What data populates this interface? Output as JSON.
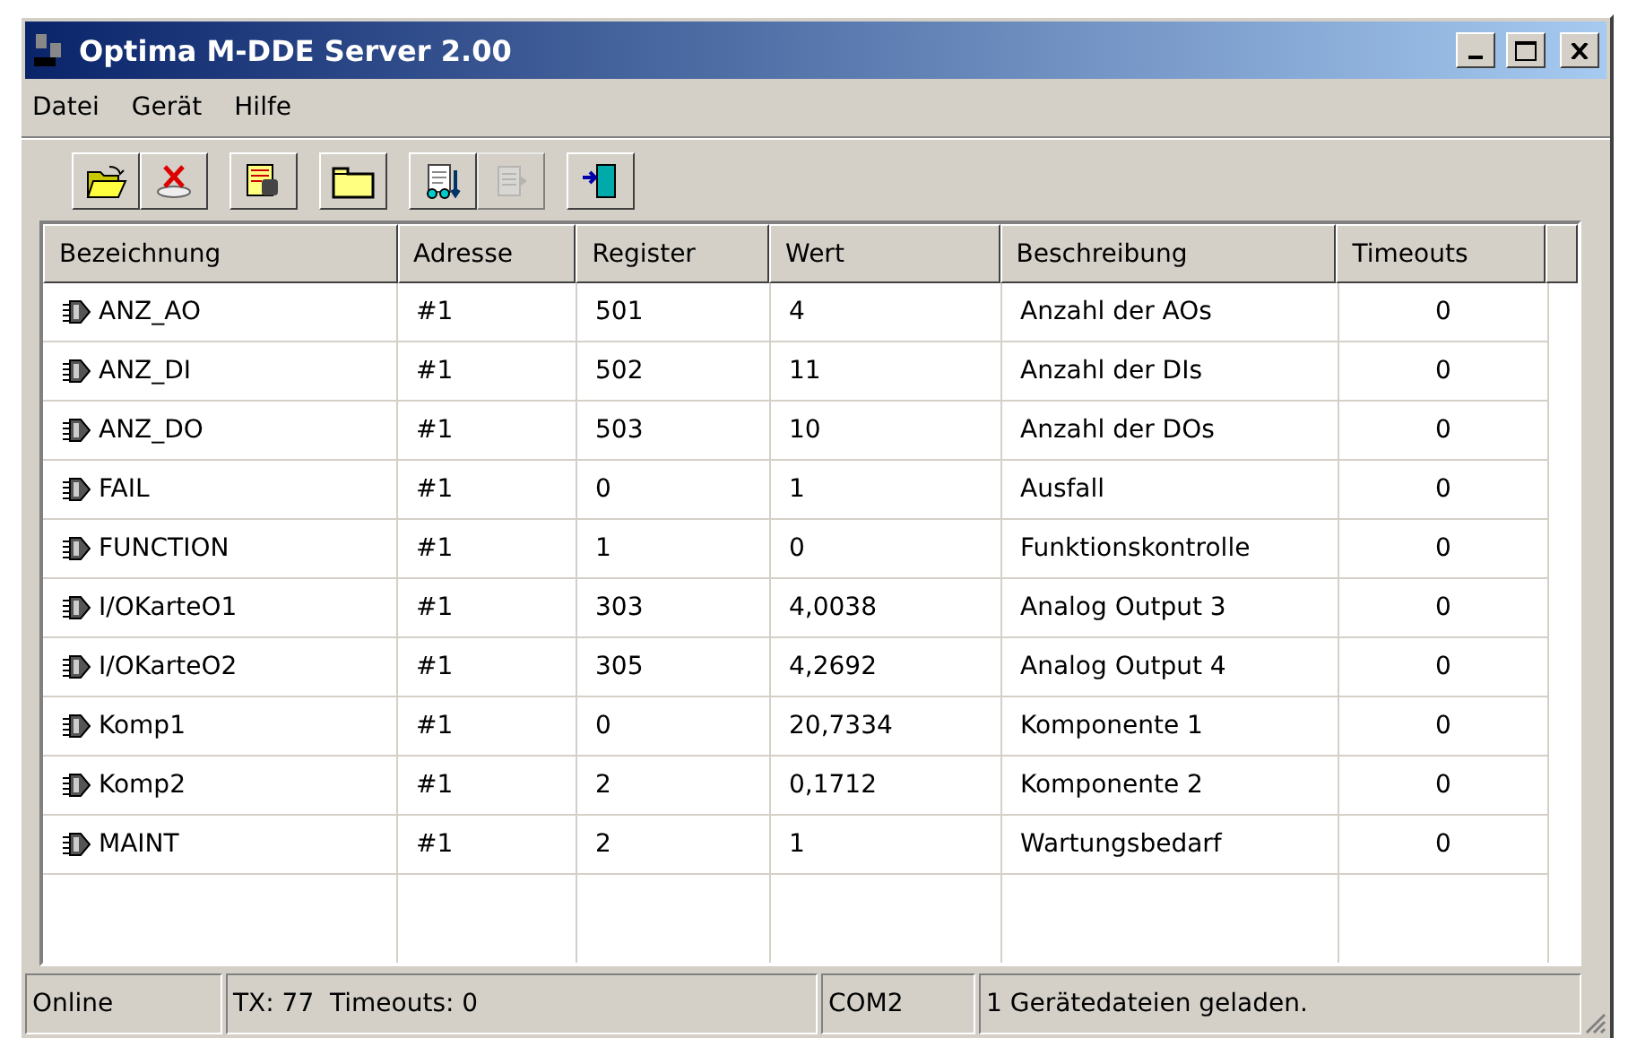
{
  "window": {
    "title": "Optima M-DDE Server 2.00"
  },
  "menu": [
    {
      "label": "Datei"
    },
    {
      "label": "Gerät"
    },
    {
      "label": "Hilfe"
    }
  ],
  "toolbar": [
    [
      {
        "kind": "open",
        "disabled": false
      },
      {
        "kind": "delete",
        "disabled": false
      }
    ],
    [
      {
        "kind": "device",
        "disabled": false
      }
    ],
    [
      {
        "kind": "folder",
        "disabled": false
      }
    ],
    [
      {
        "kind": "report",
        "disabled": false
      },
      {
        "kind": "document",
        "disabled": true
      }
    ],
    [
      {
        "kind": "exit",
        "disabled": false
      }
    ]
  ],
  "table": {
    "columns": [
      "Bezeichnung",
      "Adresse",
      "Register",
      "Wert",
      "Beschreibung",
      "Timeouts"
    ],
    "rows": [
      [
        "ANZ_AO",
        "#1",
        "501",
        "4",
        "Anzahl der AOs",
        "0"
      ],
      [
        "ANZ_DI",
        "#1",
        "502",
        "11",
        "Anzahl der DIs",
        "0"
      ],
      [
        "ANZ_DO",
        "#1",
        "503",
        "10",
        "Anzahl der DOs",
        "0"
      ],
      [
        "FAIL",
        "#1",
        "0",
        "1",
        "Ausfall",
        "0"
      ],
      [
        "FUNCTION",
        "#1",
        "1",
        "0",
        "Funktionskontrolle",
        "0"
      ],
      [
        "I/OKarteO1",
        "#1",
        "303",
        "4,0038",
        "Analog Output 3",
        "0"
      ],
      [
        "I/OKarteO2",
        "#1",
        "305",
        "4,2692",
        "Analog Output 4",
        "0"
      ],
      [
        "Komp1",
        "#1",
        "0",
        "20,7334",
        "Komponente 1",
        "0"
      ],
      [
        "Komp2",
        "#1",
        "2",
        "0,1712",
        "Komponente 2",
        "0"
      ],
      [
        "MAINT",
        "#1",
        "2",
        "1",
        "Wartungsbedarf",
        "0"
      ]
    ]
  },
  "status_bar": [
    "Online",
    "TX: 77  Timeouts: 0",
    "COM2",
    "1 Gerätedateien geladen."
  ]
}
